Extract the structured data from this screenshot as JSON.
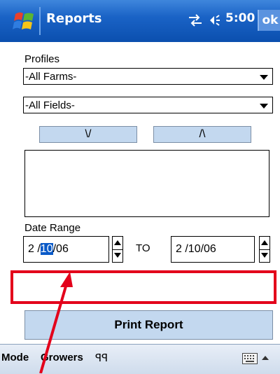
{
  "titlebar": {
    "title": "Reports",
    "time": "5:00",
    "ok_label": "ok"
  },
  "icons": {
    "start": "windows-flag-icon",
    "connectivity": "connectivity-arrows-icon",
    "volume": "speaker-volume-icon",
    "keyboard": "keyboard-icon"
  },
  "form": {
    "profiles_label": "Profiles",
    "farms_select": "-All Farms-",
    "fields_select": "-All Fields-",
    "move_down_label": "\\/",
    "move_up_label": "/\\",
    "date_range_label": "Date Range",
    "start_date": {
      "prefix": "2 /",
      "selected": "10",
      "suffix": "/06"
    },
    "to_label": "TO",
    "end_date": "2 /10/06",
    "print_button": "Print Report"
  },
  "menubar": {
    "mode_label": "Mode",
    "growers_label": "Growers",
    "extra_glyph": "ꟼꟼ"
  },
  "colors": {
    "title_bar": "#0e56b8",
    "highlight_border": "#e3001b",
    "button_fill": "#c3d8ef"
  }
}
